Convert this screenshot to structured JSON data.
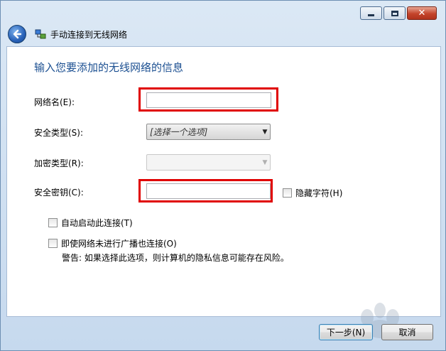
{
  "window": {
    "title": "手动连接到无线网络",
    "caption": {
      "minimize": "minimize-icon",
      "maximize": "maximize-icon",
      "close": "close-icon"
    }
  },
  "form": {
    "heading": "输入您要添加的无线网络的信息",
    "network_name_label": "网络名(E):",
    "network_name_value": "",
    "security_type_label": "安全类型(S):",
    "security_type_value": "[选择一个选项]",
    "encryption_type_label": "加密类型(R):",
    "encryption_type_value": "",
    "security_key_label": "安全密钥(C):",
    "security_key_value": "",
    "hide_chars_label": "隐藏字符(H)",
    "auto_start_label": "自动启动此连接(T)",
    "connect_even_label": "即使网络未进行广播也连接(O)",
    "warning": "警告: 如果选择此选项，则计算机的隐私信息可能存在风险。"
  },
  "buttons": {
    "next": "下一步(N)",
    "cancel": "取消"
  },
  "colors": {
    "accent_heading": "#1b4f91",
    "highlight": "#e00000"
  }
}
